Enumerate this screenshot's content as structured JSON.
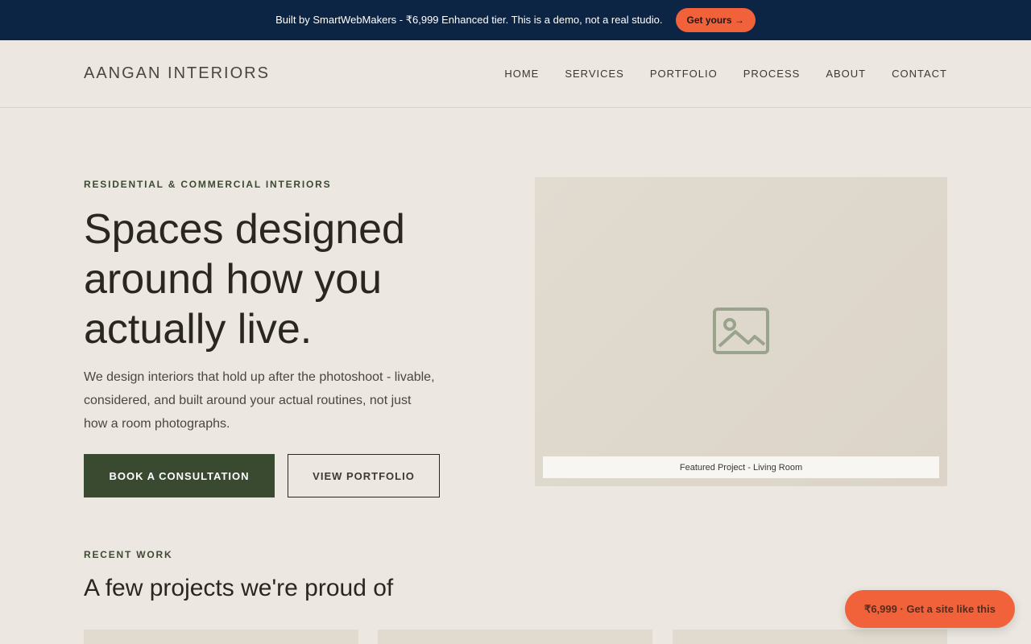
{
  "banner": {
    "text": "Built by SmartWebMakers - ₹6,999 Enhanced tier. This is a demo, not a real studio.",
    "cta_label": "Get yours →"
  },
  "header": {
    "logo": "AANGAN INTERIORS",
    "nav": [
      "HOME",
      "SERVICES",
      "PORTFOLIO",
      "PROCESS",
      "ABOUT",
      "CONTACT"
    ]
  },
  "hero": {
    "eyebrow": "RESIDENTIAL & COMMERCIAL INTERIORS",
    "title": "Spaces designed around how you actually live.",
    "description": "We design interiors that hold up after the photoshoot - livable, considered, and built around your actual routines, not just how a room photographs.",
    "primary_cta": "BOOK A CONSULTATION",
    "secondary_cta": "VIEW PORTFOLIO",
    "image_caption": "Featured Project - Living Room",
    "image_icon": "image-placeholder-icon"
  },
  "recent_work": {
    "label": "RECENT WORK",
    "title": "A few projects we're proud of"
  },
  "floating_cta": {
    "label": "₹6,999 · Get a site like this"
  },
  "colors": {
    "banner_bg": "#0d2545",
    "accent": "#f1623a",
    "primary": "#3a4a30",
    "background": "#ece8e1"
  }
}
